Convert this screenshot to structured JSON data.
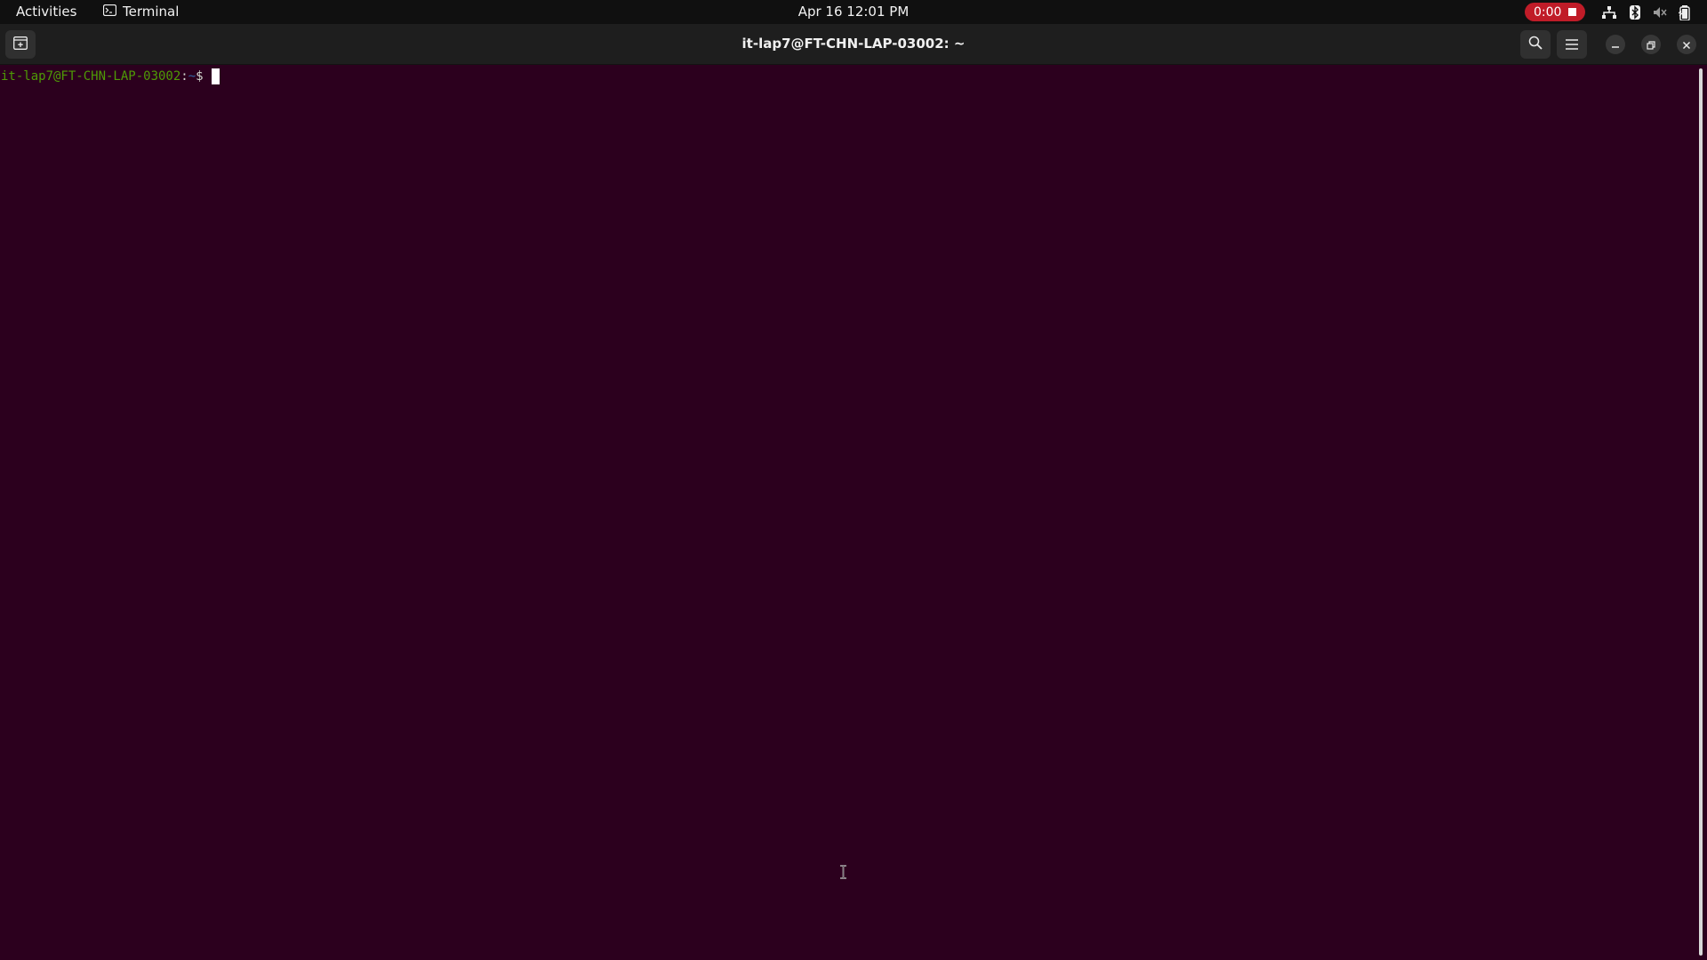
{
  "topbar": {
    "activities": "Activities",
    "app_name": "Terminal",
    "clock": "Apr 16  12:01 PM",
    "recording_time": "0:00"
  },
  "window": {
    "title": "it-lap7@FT-CHN-LAP-03002: ~"
  },
  "terminal": {
    "prompt_user_host": "it-lap7@FT-CHN-LAP-03002",
    "prompt_colon": ":",
    "prompt_path": "~",
    "prompt_symbol": "$"
  },
  "colors": {
    "terminal_bg": "#2c001e",
    "prompt_user": "#4e9a06",
    "prompt_path": "#3465a4",
    "record_badge": "#c01c28"
  },
  "icons": [
    "terminal-app-icon",
    "network-icon",
    "bluetooth-icon",
    "volume-muted-icon",
    "battery-icon",
    "new-tab-icon",
    "search-icon",
    "hamburger-menu-icon",
    "minimize-icon",
    "restore-icon",
    "close-icon"
  ]
}
